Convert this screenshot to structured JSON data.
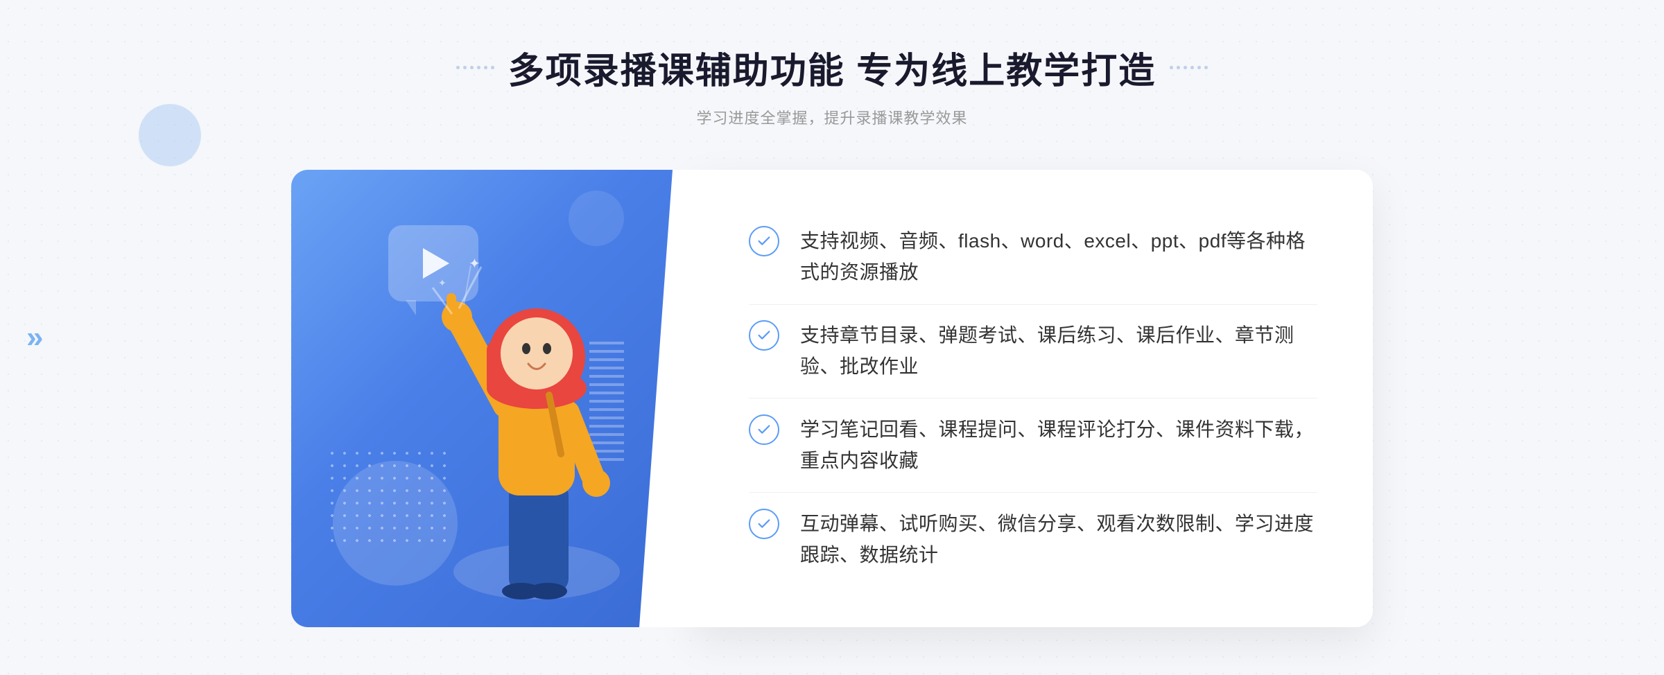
{
  "header": {
    "title": "多项录播课辅助功能 专为线上教学打造",
    "subtitle": "学习进度全掌握，提升录播课教学效果",
    "title_deco_left": ":::",
    "title_deco_right": ":::"
  },
  "features": [
    {
      "id": 1,
      "text": "支持视频、音频、flash、word、excel、ppt、pdf等各种格式的资源播放"
    },
    {
      "id": 2,
      "text": "支持章节目录、弹题考试、课后练习、课后作业、章节测验、批改作业"
    },
    {
      "id": 3,
      "text": "学习笔记回看、课程提问、课程评论打分、课件资料下载，重点内容收藏"
    },
    {
      "id": 4,
      "text": "互动弹幕、试听购买、微信分享、观看次数限制、学习进度跟踪、数据统计"
    }
  ],
  "colors": {
    "blue_gradient_start": "#6aa3f5",
    "blue_gradient_end": "#3a6bd4",
    "check_border": "#5b9cf6",
    "title_color": "#1a1a2e",
    "subtitle_color": "#999999",
    "text_color": "#333333"
  },
  "decoration": {
    "arrow_left": "»"
  }
}
